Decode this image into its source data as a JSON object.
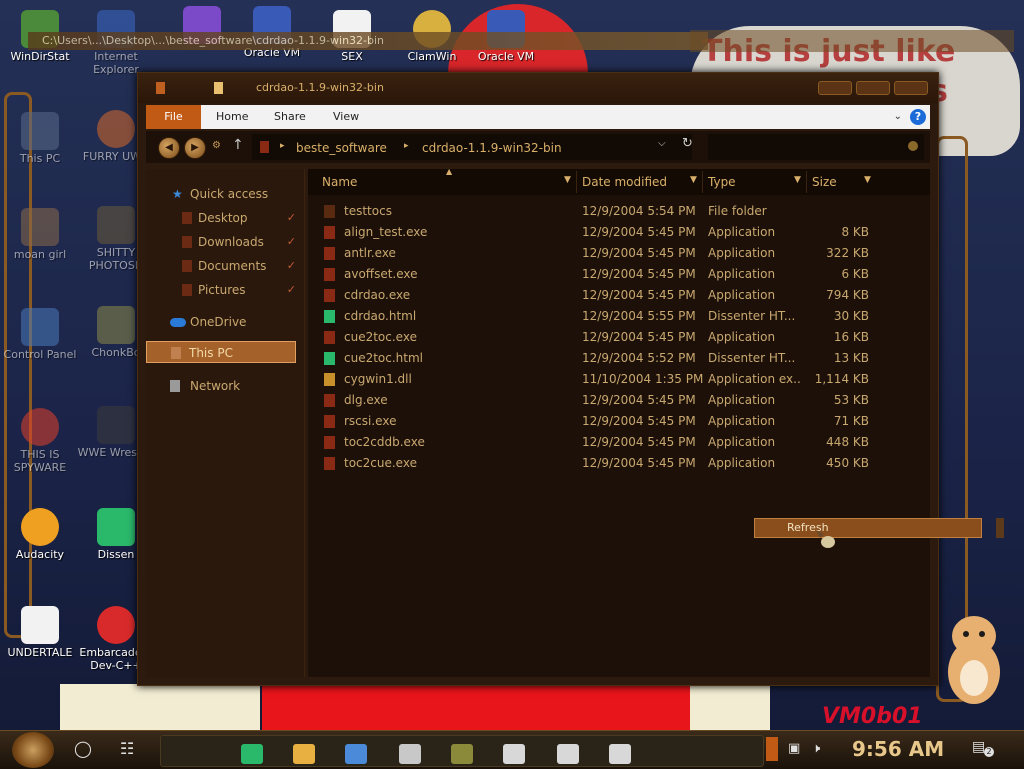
{
  "window": {
    "title": "cdrdao-1.1.9-win32-bin",
    "ghost_path": "C:\\Users\\...\\Desktop\\...\\beste_software\\cdrdao-1.1.9-win32-bin"
  },
  "ribbon": {
    "tabs": [
      "File",
      "Home",
      "Share",
      "View"
    ]
  },
  "address": {
    "crumbs": [
      "beste_software",
      "cdrdao-1.1.9-win32-bin"
    ],
    "search_placeholder": ""
  },
  "nav": {
    "quick_access": "Quick access",
    "items": [
      "Desktop",
      "Downloads",
      "Documents",
      "Pictures"
    ],
    "onedrive": "OneDrive",
    "thispc": "This PC",
    "network": "Network"
  },
  "columns": {
    "name": "Name",
    "date": "Date modified",
    "type": "Type",
    "size": "Size"
  },
  "files": [
    {
      "name": "testtocs",
      "date": "12/9/2004 5:54 PM",
      "type": "File folder",
      "size": "",
      "icon": "folder-icon"
    },
    {
      "name": "align_test.exe",
      "date": "12/9/2004 5:45 PM",
      "type": "Application",
      "size": "8 KB",
      "icon": "exe-icon"
    },
    {
      "name": "antlr.exe",
      "date": "12/9/2004 5:45 PM",
      "type": "Application",
      "size": "322 KB",
      "icon": "exe-icon"
    },
    {
      "name": "avoffset.exe",
      "date": "12/9/2004 5:45 PM",
      "type": "Application",
      "size": "6 KB",
      "icon": "exe-icon"
    },
    {
      "name": "cdrdao.exe",
      "date": "12/9/2004 5:45 PM",
      "type": "Application",
      "size": "794 KB",
      "icon": "exe-icon"
    },
    {
      "name": "cdrdao.html",
      "date": "12/9/2004 5:55 PM",
      "type": "Dissenter HT...",
      "size": "30 KB",
      "icon": "html-icon"
    },
    {
      "name": "cue2toc.exe",
      "date": "12/9/2004 5:45 PM",
      "type": "Application",
      "size": "16 KB",
      "icon": "exe-icon"
    },
    {
      "name": "cue2toc.html",
      "date": "12/9/2004 5:52 PM",
      "type": "Dissenter HT...",
      "size": "13 KB",
      "icon": "html-icon"
    },
    {
      "name": "cygwin1.dll",
      "date": "11/10/2004 1:35 PM",
      "type": "Application ex...",
      "size": "1,114 KB",
      "icon": "dll-icon"
    },
    {
      "name": "dlg.exe",
      "date": "12/9/2004 5:45 PM",
      "type": "Application",
      "size": "53 KB",
      "icon": "exe-icon"
    },
    {
      "name": "rscsi.exe",
      "date": "12/9/2004 5:45 PM",
      "type": "Application",
      "size": "71 KB",
      "icon": "exe-icon"
    },
    {
      "name": "toc2cddb.exe",
      "date": "12/9/2004 5:45 PM",
      "type": "Application",
      "size": "448 KB",
      "icon": "exe-icon"
    },
    {
      "name": "toc2cue.exe",
      "date": "12/9/2004 5:45 PM",
      "type": "Application",
      "size": "450 KB",
      "icon": "exe-icon"
    }
  ],
  "context_menu": {
    "refresh": "Refresh"
  },
  "desktop": {
    "icons": [
      "WinDirStat",
      "Internet Explorer",
      "Oracle VM",
      "SEX",
      "ClamWin",
      "Oracle VM",
      "This PC",
      "FURRY UWU",
      "moan girl",
      "SHITTY PHOTOSH",
      "Control Panel",
      "ChonkBo",
      "THIS IS SPYWARE",
      "WWE Wrestlin",
      "Audacity",
      "Dissen",
      "UNDERTALE",
      "Embarcadero Dev-C++"
    ],
    "wall_text_1": "This is just like",
    "wall_text_2": "s",
    "vm_text": "VM0b01"
  },
  "taskbar": {
    "time": "9:56 AM",
    "notifications": "2"
  },
  "colors": {
    "accent": "#c05a14",
    "text": "#c9a870",
    "window_bg": "#1c1008"
  }
}
